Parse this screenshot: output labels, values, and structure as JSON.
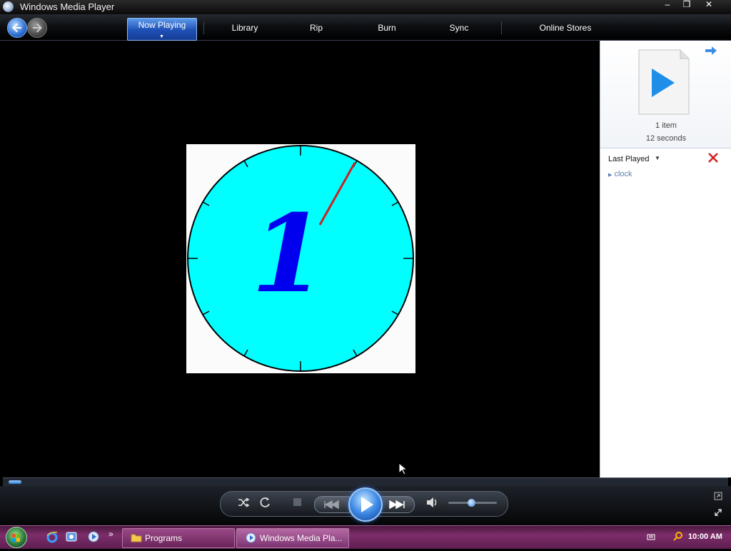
{
  "window": {
    "title": "Windows Media Player"
  },
  "titlebar": {
    "minimize": "–",
    "restore": "❐",
    "close": "✕"
  },
  "nav": {
    "tabs": [
      {
        "label": "Now Playing"
      },
      {
        "label": "Library"
      },
      {
        "label": "Rip"
      },
      {
        "label": "Burn"
      },
      {
        "label": "Sync"
      },
      {
        "label": "Online Stores"
      }
    ]
  },
  "now_playing": {
    "video_title": "clock",
    "clock_digit": "1"
  },
  "right_pane": {
    "items_count": "1 item",
    "duration": "12 seconds",
    "playlist_name": "Last Played",
    "items": [
      {
        "label": "clock"
      }
    ]
  },
  "controls": {
    "shuffle_icon": "shuffle-icon",
    "repeat_icon": "repeat-icon",
    "stop_icon": "stop-icon",
    "previous_icon": "previous-icon",
    "play_icon": "play-icon",
    "next_icon": "next-icon",
    "mute_icon": "speaker-icon",
    "volume_level": 0.45,
    "seek_position": 0.0
  },
  "taskbar": {
    "programs_label": "Programs",
    "wmp_label": "Windows Media Pla...",
    "quicklaunch_more": "»",
    "time": "10:00 AM"
  },
  "colors": {
    "accent": "#2c6fd4",
    "clock_face": "#00ffff",
    "clock_hand": "#cc2222",
    "digit": "#0000ee",
    "taskbar": "#7d2d6a"
  }
}
